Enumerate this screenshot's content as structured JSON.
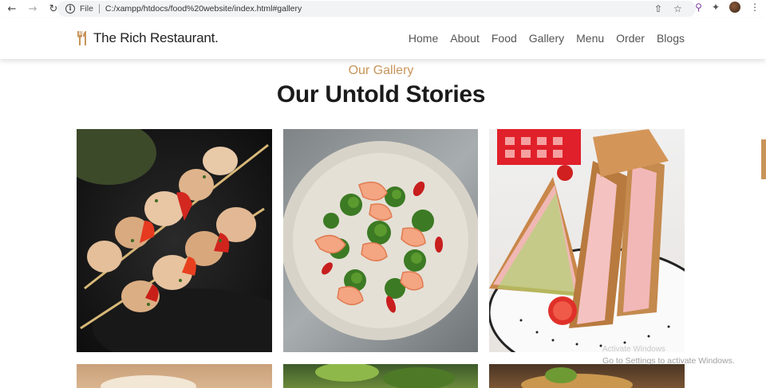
{
  "browser": {
    "file_label": "File",
    "url": "C:/xampp/htdocs/food%20website/index.html#gallery"
  },
  "site": {
    "logo_text": "The Rich Restaurant.",
    "nav": [
      "Home",
      "About",
      "Food",
      "Gallery",
      "Menu",
      "Order",
      "Blogs"
    ]
  },
  "section": {
    "subtitle": "Our Gallery",
    "title": "Our Untold Stories"
  },
  "gallery": [
    {
      "icon": "chicken-skewers-image"
    },
    {
      "icon": "shrimp-broccoli-image"
    },
    {
      "icon": "sandwich-image"
    },
    {
      "icon": "baking-image"
    },
    {
      "icon": "salad-image"
    },
    {
      "icon": "food-plate-image"
    }
  ],
  "watermark": {
    "line1": "Activate Windows",
    "line2": "Go to Settings to activate Windows."
  },
  "colors": {
    "accent": "#c8945a",
    "heading": "#1b1b1b"
  }
}
